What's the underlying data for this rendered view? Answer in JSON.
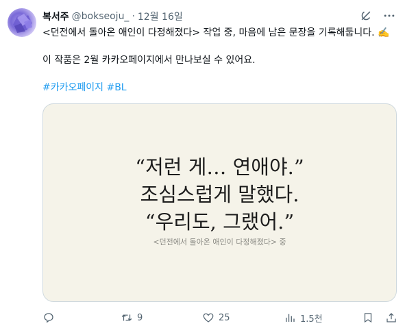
{
  "author": {
    "name": "복서주",
    "handle": "@bokseoju_",
    "separator": "·",
    "date": "12월 16일"
  },
  "top_icons": [
    "grok-icon",
    "more-icon"
  ],
  "tweet": {
    "line1": "<던전에서 돌아온 애인이 다정해졌다> 작업 중, 마음에 남은 문장을 기록해둡니다. ✍️",
    "line2": "이 작품은 2월 카카오페이지에서 만나보실 수 있어요.",
    "hashtags": [
      "#카카오페이지",
      "#BL"
    ]
  },
  "image": {
    "quote_line1": "“저런 게… 연애야.”",
    "quote_line2": "조심스럽게 말했다.",
    "quote_line3": "“우리도, 그랬어.”",
    "source": "<던전에서 돌아온 애인이 다정해졌다> 중",
    "background": "#f5f3e9"
  },
  "actions": {
    "reply": "",
    "retweet": "9",
    "like": "25",
    "views": "1.5천"
  },
  "colors": {
    "text": "#0f1419",
    "muted": "#536471",
    "link": "#1d9bf0"
  }
}
